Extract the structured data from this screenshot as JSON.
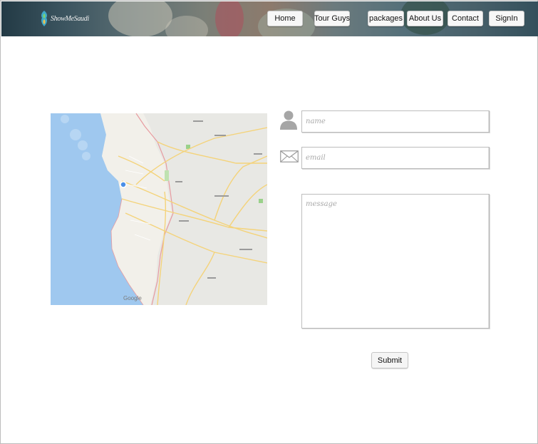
{
  "header": {
    "logo_text": "ShowMeSaudi",
    "nav": [
      {
        "label": "Home"
      },
      {
        "label": "Tour Guys"
      },
      {
        "label": "packages"
      },
      {
        "label": "About Us"
      },
      {
        "label": "Contact"
      },
      {
        "label": "SignIn"
      }
    ]
  },
  "map": {
    "attribution": "Google"
  },
  "form": {
    "name_placeholder": "name",
    "email_placeholder": "email",
    "message_placeholder": "message",
    "submit_label": "Submit",
    "icons": {
      "name": "user-icon",
      "email": "envelope-icon"
    }
  },
  "colors": {
    "header_dark": "#233a45",
    "button_bg": "#f7f7f7",
    "map_sea": "#9fc8ef",
    "map_land": "#e8e8e4",
    "map_city": "#f2f0ea",
    "map_road": "#f4d37a"
  }
}
